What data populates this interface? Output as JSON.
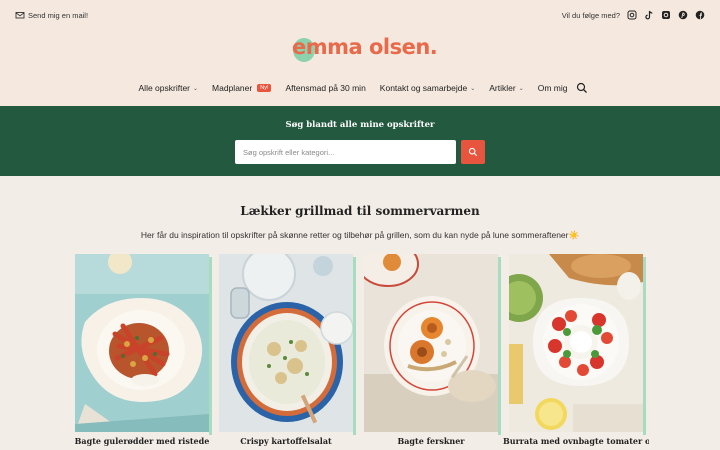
{
  "topbar": {
    "mail_label": "Send mig en mail!",
    "follow_label": "Vil du følge med?",
    "social": [
      "instagram-icon",
      "tiktok-icon",
      "instagram-icon",
      "pinterest-icon",
      "facebook-icon"
    ]
  },
  "logo": {
    "text": "emma olsen."
  },
  "nav": {
    "items": [
      {
        "label": "Alle opskrifter",
        "chevron": true
      },
      {
        "label": "Madplaner",
        "badge": "Ny!"
      },
      {
        "label": "Aftensmad på 30 min"
      },
      {
        "label": "Kontakt og samarbejde",
        "chevron": true
      },
      {
        "label": "Artikler",
        "chevron": true
      },
      {
        "label": "Om mig"
      }
    ]
  },
  "hero": {
    "title": "Søg blandt alle mine opskrifter",
    "search_placeholder": "Søg opskrift eller kategori..."
  },
  "section": {
    "title": "Lækker grillmad til sommervarmen",
    "description": "Her får du inspiration til opskrifter på skønne retter og tilbehør på grillen, som du kan nyde på lune sommeraftener☀️"
  },
  "cards": [
    {
      "title": "Bagte gulerødder med ristede"
    },
    {
      "title": "Crispy kartoffelsalat"
    },
    {
      "title": "Bagte ferskner"
    },
    {
      "title": "Burrata med ovnbagte tomater og"
    }
  ],
  "colors": {
    "topbar_bg": "#f5e9df",
    "hero_bg": "#23593f",
    "accent": "#e8553e",
    "logo_text": "#e86a4b",
    "card_accent": "#a8dcc0"
  }
}
